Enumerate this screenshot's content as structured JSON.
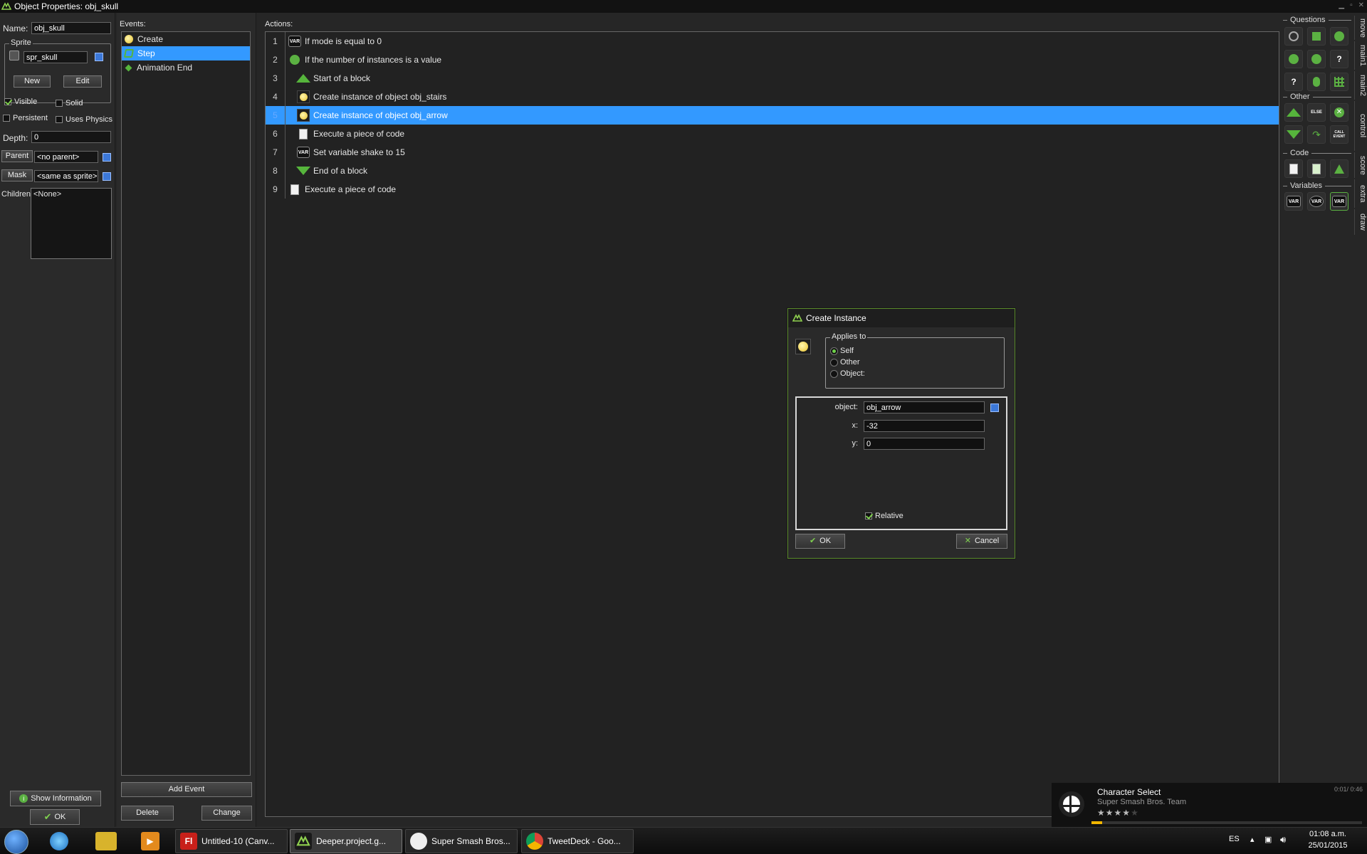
{
  "window": {
    "title": "Object Properties: obj_skull"
  },
  "props": {
    "name_label": "Name:",
    "name_value": "obj_skull",
    "sprite_group": "Sprite",
    "sprite_value": "spr_skull",
    "new_label": "New",
    "edit_label": "Edit",
    "visible_label": "Visible",
    "solid_label": "Solid",
    "persistent_label": "Persistent",
    "uses_physics_label": "Uses Physics",
    "depth_label": "Depth:",
    "depth_value": "0",
    "parent_label": "Parent",
    "parent_value": "<no parent>",
    "mask_label": "Mask",
    "mask_value": "<same as sprite>",
    "children_label": "Children:",
    "children_value": "<None>",
    "show_info_label": "Show Information",
    "ok_label": "OK"
  },
  "events": {
    "label": "Events:",
    "items": [
      {
        "label": "Create",
        "icon": "bulb-icon"
      },
      {
        "label": "Step",
        "icon": "step-icon"
      },
      {
        "label": "Animation End",
        "icon": "diamond-icon"
      }
    ],
    "selected_index": 1,
    "add_event_label": "Add Event",
    "delete_label": "Delete",
    "change_label": "Change"
  },
  "actions": {
    "label": "Actions:",
    "rows": [
      {
        "num": "1",
        "text": "If mode is equal to 0",
        "icon": "var-icon"
      },
      {
        "num": "2",
        "text": "If the number of instances is a value",
        "icon": "instance-count-icon"
      },
      {
        "num": "3",
        "text": "Start of a block",
        "icon": "triangle-up-icon"
      },
      {
        "num": "4",
        "text": "Create instance of object obj_stairs",
        "icon": "bulb-icon"
      },
      {
        "num": "5",
        "text": "Create instance of object obj_arrow",
        "icon": "bulb-icon"
      },
      {
        "num": "6",
        "text": "Execute a piece of code",
        "icon": "code-icon"
      },
      {
        "num": "7",
        "text": "Set variable shake to 15",
        "icon": "var-icon"
      },
      {
        "num": "8",
        "text": "End of a block",
        "icon": "triangle-down-icon"
      },
      {
        "num": "9",
        "text": "Execute a piece of code",
        "icon": "code-icon"
      }
    ],
    "selected_index": 4
  },
  "palette": {
    "sections": {
      "questions": "Questions",
      "other": "Other",
      "code": "Code",
      "variables": "Variables"
    },
    "else_text": "ELSE",
    "call_event_text": "CALL EVENT",
    "var_text": "VAR",
    "tabs": [
      "move",
      "main1",
      "main2",
      "control",
      "score",
      "extra",
      "draw"
    ]
  },
  "dialog": {
    "title": "Create Instance",
    "applies_to_label": "Applies to",
    "self_label": "Self",
    "other_label": "Other",
    "object_label": "Object:",
    "selected_applies": "Self",
    "param_object_label": "object:",
    "param_object_value": "obj_arrow",
    "param_x_label": "x:",
    "param_x_value": "-32",
    "param_y_label": "y:",
    "param_y_value": "0",
    "relative_label": "Relative",
    "relative_checked": true,
    "ok_label": "OK",
    "cancel_label": "Cancel"
  },
  "media": {
    "title": "Character Select",
    "artist": "Super Smash Bros. Team",
    "time": "0:01/ 0:46",
    "rating_stars": 4,
    "progress": 0.04
  },
  "taskbar": {
    "buttons": [
      {
        "label": "Untitled-10 (Canv...",
        "icon": "flash-icon",
        "icon_text": "Fl"
      },
      {
        "label": "Deeper.project.g...",
        "icon": "gamemaker-icon",
        "icon_text": ""
      },
      {
        "label": "Super Smash Bros...",
        "icon": "media-player-icon",
        "icon_text": ""
      },
      {
        "label": "TweetDeck - Goo...",
        "icon": "chrome-icon",
        "icon_text": ""
      }
    ],
    "lang": "ES",
    "time": "01:08 a.m.",
    "date": "25/01/2015"
  }
}
